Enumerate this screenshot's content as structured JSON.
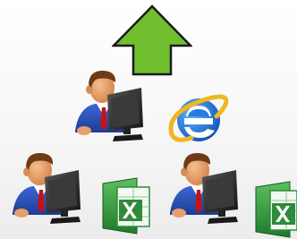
{
  "diagram": {
    "arrow": {
      "icon": "up-arrow-icon",
      "color": "#6fbf2f",
      "stroke": "#1a1a1a"
    },
    "top_node": {
      "user": "user-at-computer",
      "app": "internet-explorer-icon"
    },
    "bottom_nodes": [
      {
        "user": "user-at-computer",
        "app": "excel-icon"
      },
      {
        "user": "user-at-computer",
        "app": "excel-icon"
      }
    ]
  },
  "colors": {
    "shirt": "#2a4fb0",
    "skin": "#e7a06c",
    "hair": "#6e3a17",
    "tie": "#c0141a",
    "monitor": "#2b2b2b",
    "excel_green": "#2e8b3a",
    "ie_blue": "#1b63c6",
    "ie_ring": "#f0b623"
  }
}
